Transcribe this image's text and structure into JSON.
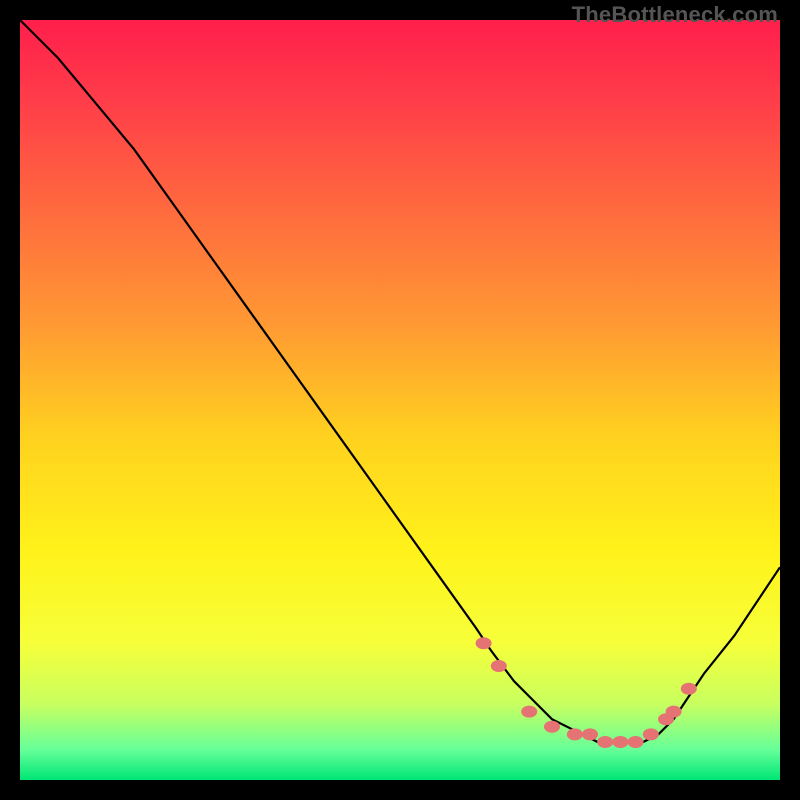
{
  "watermark": "TheBottleneck.com",
  "chart_data": {
    "type": "line",
    "title": "",
    "xlabel": "",
    "ylabel": "",
    "xlim": [
      0,
      100
    ],
    "ylim": [
      0,
      100
    ],
    "grid": false,
    "curve": {
      "name": "bottleneck-curve",
      "color": "#000000",
      "x": [
        0,
        5,
        10,
        15,
        20,
        25,
        30,
        35,
        40,
        45,
        50,
        55,
        60,
        62,
        65,
        68,
        70,
        72,
        74,
        76,
        78,
        80,
        82,
        84,
        86,
        88,
        90,
        94,
        100
      ],
      "y": [
        100,
        95,
        89,
        83,
        76,
        69,
        62,
        55,
        48,
        41,
        34,
        27,
        20,
        17,
        13,
        10,
        8,
        7,
        6,
        5,
        5,
        5,
        5,
        6,
        8,
        11,
        14,
        19,
        28
      ]
    },
    "markers": {
      "name": "highlight-points",
      "color": "#e57373",
      "x": [
        61,
        63,
        67,
        70,
        73,
        75,
        77,
        79,
        81,
        83,
        85,
        86,
        88
      ],
      "y": [
        18,
        15,
        9,
        7,
        6,
        6,
        5,
        5,
        5,
        6,
        8,
        9,
        12
      ]
    },
    "gradient_stops": [
      {
        "offset": 0.0,
        "color": "#ff1f4b"
      },
      {
        "offset": 0.1,
        "color": "#ff3b4a"
      },
      {
        "offset": 0.25,
        "color": "#ff6a3e"
      },
      {
        "offset": 0.4,
        "color": "#ff9933"
      },
      {
        "offset": 0.55,
        "color": "#ffd21f"
      },
      {
        "offset": 0.7,
        "color": "#fff21a"
      },
      {
        "offset": 0.82,
        "color": "#f6ff3a"
      },
      {
        "offset": 0.9,
        "color": "#c8ff5f"
      },
      {
        "offset": 0.96,
        "color": "#66ff99"
      },
      {
        "offset": 1.0,
        "color": "#00e676"
      }
    ]
  }
}
